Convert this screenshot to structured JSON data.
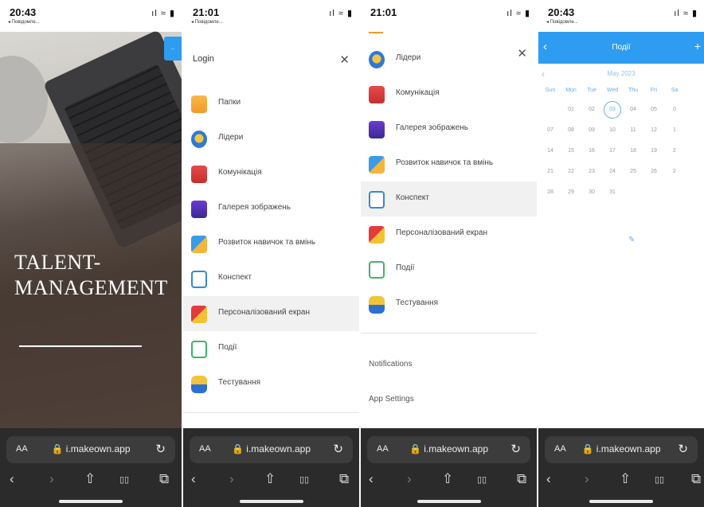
{
  "phones": {
    "p1": {
      "time": "20:43",
      "back_app": "◂ Повідомле...",
      "indicators": "ıl ≈ ▮",
      "hero_title_line1": "TALENT-",
      "hero_title_line2": "MANAGEMENT",
      "corner_btn": "..."
    },
    "p2": {
      "time": "21:01",
      "back_app": "◂ Повідомле...",
      "indicators": "ıl ≈ ▮",
      "login": "Login",
      "close": "✕",
      "items": [
        {
          "label": "Папки",
          "icon": "folders-icon"
        },
        {
          "label": "Лідери",
          "icon": "leaders-icon"
        },
        {
          "label": "Комунікація",
          "icon": "communication-icon"
        },
        {
          "label": "Галерея зображень",
          "icon": "gallery-icon"
        },
        {
          "label": "Розвиток навичок та вмінь",
          "icon": "skills-icon"
        },
        {
          "label": "Конспект",
          "icon": "notes-icon"
        },
        {
          "label": "Персоналізований екран",
          "icon": "custom-screen-icon"
        },
        {
          "label": "Події",
          "icon": "events-icon"
        },
        {
          "label": "Тестування",
          "icon": "tests-icon"
        }
      ]
    },
    "p3": {
      "time": "21:01",
      "indicators": "ıl ≈ ▮",
      "close": "✕",
      "items": [
        {
          "label": "Лідери",
          "icon": "leaders-icon"
        },
        {
          "label": "Комунікація",
          "icon": "communication-icon"
        },
        {
          "label": "Галерея зображень",
          "icon": "gallery-icon"
        },
        {
          "label": "Розвиток навичок та вмінь",
          "icon": "skills-icon"
        },
        {
          "label": "Конспект",
          "icon": "notes-icon"
        },
        {
          "label": "Персоналізований екран",
          "icon": "custom-screen-icon"
        },
        {
          "label": "Події",
          "icon": "events-icon"
        },
        {
          "label": "Тестування",
          "icon": "tests-icon"
        }
      ],
      "notifications": "Notifications",
      "app_settings": "App Settings"
    },
    "p4": {
      "time": "20:43",
      "back_app": "◂ Повідомле...",
      "indicators": "ıl ≈ ▮",
      "header_title": "Події",
      "month": "May 2023",
      "weekdays": [
        "Sun",
        "Mon",
        "Tue",
        "Wed",
        "Thu",
        "Fri",
        "Sa"
      ],
      "days": [
        [
          "",
          "01",
          "02",
          "03",
          "04",
          "05",
          "0"
        ],
        [
          "07",
          "08",
          "09",
          "10",
          "11",
          "12",
          "1"
        ],
        [
          "14",
          "15",
          "16",
          "17",
          "18",
          "19",
          "2"
        ],
        [
          "21",
          "22",
          "23",
          "24",
          "25",
          "26",
          "2"
        ],
        [
          "28",
          "29",
          "30",
          "31",
          "",
          "",
          ""
        ]
      ],
      "today": "03"
    }
  },
  "browser": {
    "aa": "AA",
    "url": "🔒 i.makeown.app",
    "reload": "↻",
    "nav_back": "‹",
    "nav_fwd": "›",
    "share": "⇧",
    "bookmarks": "▯▯",
    "tabs": "⧉"
  },
  "colors": {
    "accent": "#2e9cf0",
    "browser_bg": "#2b2b2b",
    "active_row": "#f1f1f1"
  }
}
